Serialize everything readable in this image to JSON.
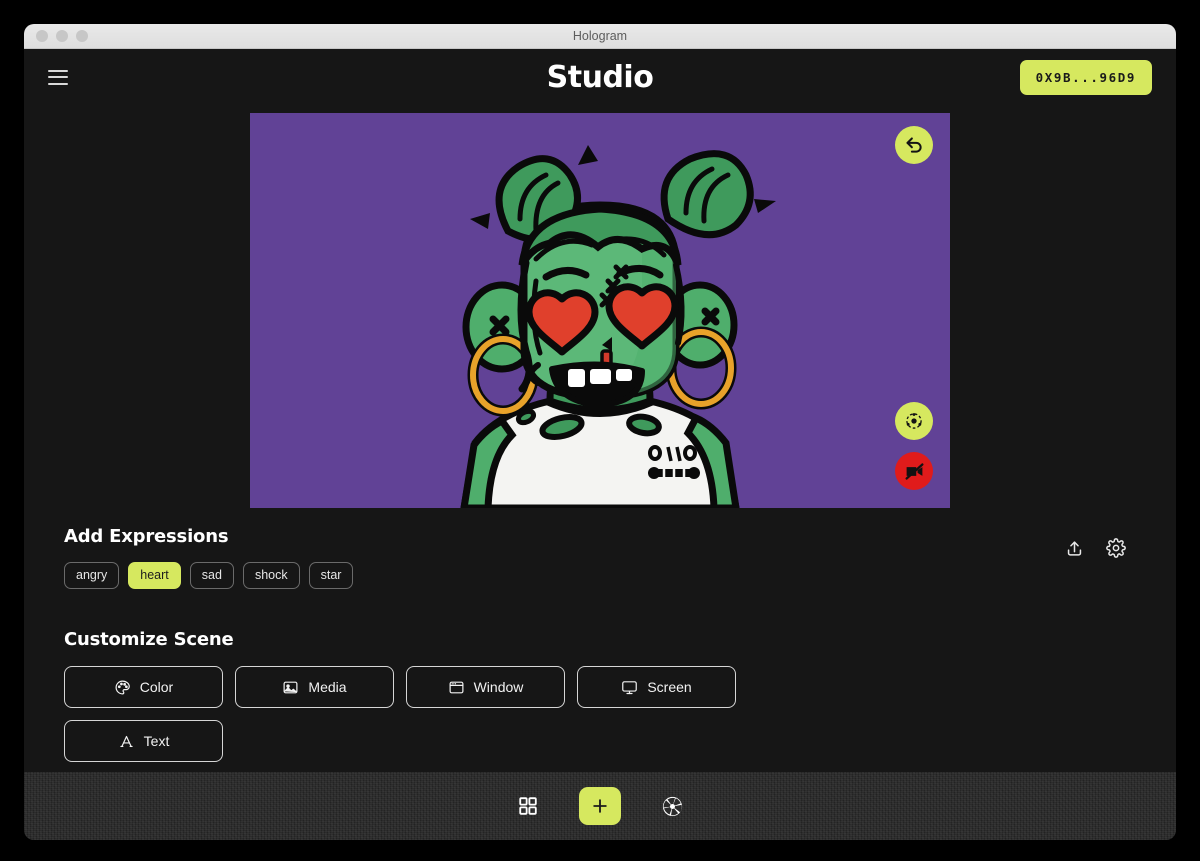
{
  "window": {
    "title": "Hologram",
    "traffic_lights": [
      "close",
      "minimize",
      "maximize"
    ]
  },
  "header": {
    "menu_icon": "hamburger-menu-icon",
    "title": "Studio",
    "wallet_label": "0X9B...96D9"
  },
  "stage": {
    "background_color": "#614296",
    "avatar": {
      "description": "green zombie character with heart eyes, twin hair buns, gold hoop earrings, stitched forehead, white t-shirt",
      "skin_color": "#5cb878",
      "skin_shadow": "#3f9a5c",
      "hair_color": "#3f9a5c",
      "eye_color": "#e0402c",
      "earring_color": "#e8a22a",
      "shirt_color": "#f4f4f2"
    },
    "buttons": [
      {
        "name": "undo-button",
        "icon": "undo-arrow-icon",
        "color": "#d6e85f"
      },
      {
        "name": "effects-button",
        "icon": "aperture-dots-icon",
        "color": "#d6e85f"
      },
      {
        "name": "camera-off-button",
        "icon": "video-off-icon",
        "color": "#e01b1b"
      }
    ]
  },
  "expressions": {
    "title": "Add Expressions",
    "chips": [
      {
        "label": "angry",
        "selected": false
      },
      {
        "label": "heart",
        "selected": true
      },
      {
        "label": "sad",
        "selected": false
      },
      {
        "label": "shock",
        "selected": false
      },
      {
        "label": "star",
        "selected": false
      }
    ]
  },
  "tools": [
    {
      "name": "share-button",
      "icon": "upload-icon"
    },
    {
      "name": "settings-button",
      "icon": "gear-icon"
    }
  ],
  "scene": {
    "title": "Customize Scene",
    "buttons": [
      {
        "label": "Color",
        "icon": "palette-icon"
      },
      {
        "label": "Media",
        "icon": "image-icon"
      },
      {
        "label": "Window",
        "icon": "browser-window-icon"
      },
      {
        "label": "Screen",
        "icon": "monitor-icon"
      },
      {
        "label": "Text",
        "icon": "text-a-icon"
      }
    ]
  },
  "bottombar": {
    "buttons": [
      {
        "name": "grid-view-button",
        "icon": "grid-icon",
        "label": ""
      },
      {
        "name": "add-button",
        "icon": "plus-icon",
        "label": "+"
      },
      {
        "name": "capture-button",
        "icon": "shutter-icon",
        "label": ""
      }
    ]
  },
  "colors": {
    "accent": "#d6e85f",
    "danger": "#e01b1b",
    "app_background": "#161616",
    "bottombar_background": "#2b2b2b"
  }
}
